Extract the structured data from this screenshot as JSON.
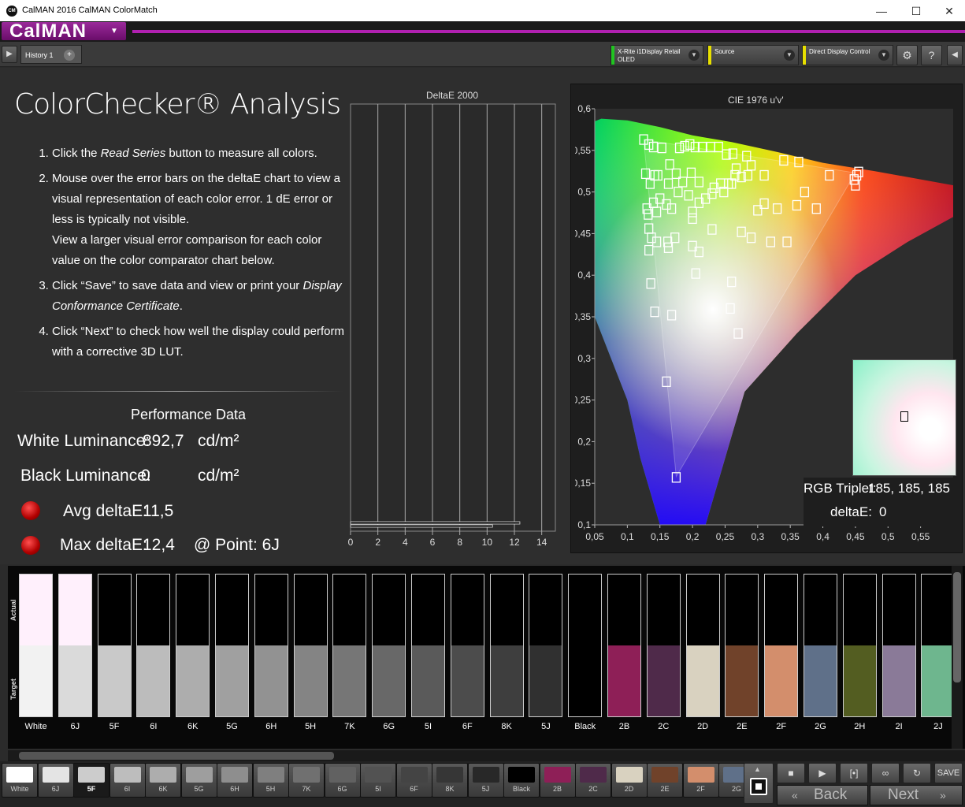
{
  "window": {
    "title": "CalMAN 2016 CalMAN ColorMatch",
    "app_badge": "CM"
  },
  "brand": {
    "name": "CalMAN"
  },
  "toolbar": {
    "history_tab": "History 1",
    "meter": {
      "line1": "X-Rite i1Display Retail",
      "line2": "OLED",
      "color": "#21c521"
    },
    "source": {
      "line1": "Source",
      "color": "#e8e000"
    },
    "display": {
      "line1": "Direct Display Control",
      "color": "#e8e000"
    }
  },
  "page": {
    "heading": "ColorChecker® Analysis",
    "steps": [
      [
        "Click the ",
        "Read Series",
        " button to measure all colors."
      ],
      [
        "Mouse over the error bars on the deltaE chart to view a visual representation of each color error. 1 dE error or less is typically not visible.",
        "View a larger visual error comparison for each color value on the color comparator chart below."
      ],
      [
        "Click “Save” to save data and view or print your ",
        "Display Conformance Certificate",
        "."
      ],
      [
        "Click “Next” to check how well the display could perform with a corrective 3D LUT."
      ]
    ]
  },
  "performance": {
    "title": "Performance Data",
    "white_label": "White Luminance:",
    "white_value": "892,7",
    "white_unit": "cd/m²",
    "black_label": "Black Luminance:",
    "black_value": "0",
    "black_unit": "cd/m²",
    "avg_label": "Avg deltaE:",
    "avg_value": "11,5",
    "max_label": "Max deltaE:",
    "max_value": "12,4",
    "point_label": "@ Point: 6J"
  },
  "chart_data": [
    {
      "type": "bar",
      "title": "DeltaE 2000",
      "orientation": "horizontal",
      "xlim": [
        0,
        15
      ],
      "xticks": [
        "0",
        "2",
        "4",
        "6",
        "8",
        "10",
        "12",
        "14"
      ],
      "values": [
        12.4,
        10.4
      ]
    },
    {
      "type": "scatter",
      "title": "CIE 1976 u'v'",
      "xlim": [
        0.05,
        0.6
      ],
      "ylim": [
        0.1,
        0.6
      ],
      "xticks": [
        "0,05",
        "0,1",
        "0,15",
        "0,2",
        "0,25",
        "0,3",
        "0,35",
        "0,4",
        "0,45",
        "0,5",
        "0,55"
      ],
      "yticks": [
        "0,1",
        "0,15",
        "0,2",
        "0,25",
        "0,3",
        "0,35",
        "0,4",
        "0,45",
        "0,5",
        "0,55",
        "0,6"
      ],
      "points": [
        [
          0.125,
          0.563
        ],
        [
          0.133,
          0.557
        ],
        [
          0.14,
          0.554
        ],
        [
          0.153,
          0.553
        ],
        [
          0.128,
          0.522
        ],
        [
          0.142,
          0.52
        ],
        [
          0.135,
          0.51
        ],
        [
          0.147,
          0.52
        ],
        [
          0.165,
          0.533
        ],
        [
          0.18,
          0.553
        ],
        [
          0.188,
          0.555
        ],
        [
          0.196,
          0.557
        ],
        [
          0.204,
          0.554
        ],
        [
          0.215,
          0.554
        ],
        [
          0.228,
          0.554
        ],
        [
          0.24,
          0.554
        ],
        [
          0.252,
          0.545
        ],
        [
          0.262,
          0.546
        ],
        [
          0.283,
          0.543
        ],
        [
          0.29,
          0.532
        ],
        [
          0.267,
          0.528
        ],
        [
          0.265,
          0.52
        ],
        [
          0.255,
          0.51
        ],
        [
          0.243,
          0.51
        ],
        [
          0.233,
          0.505
        ],
        [
          0.21,
          0.512
        ],
        [
          0.198,
          0.523
        ],
        [
          0.185,
          0.512
        ],
        [
          0.175,
          0.522
        ],
        [
          0.163,
          0.51
        ],
        [
          0.15,
          0.492
        ],
        [
          0.13,
          0.48
        ],
        [
          0.132,
          0.473
        ],
        [
          0.14,
          0.487
        ],
        [
          0.145,
          0.476
        ],
        [
          0.16,
          0.485
        ],
        [
          0.168,
          0.48
        ],
        [
          0.178,
          0.5
        ],
        [
          0.194,
          0.496
        ],
        [
          0.2,
          0.476
        ],
        [
          0.2,
          0.468
        ],
        [
          0.21,
          0.487
        ],
        [
          0.22,
          0.492
        ],
        [
          0.23,
          0.498
        ],
        [
          0.248,
          0.5
        ],
        [
          0.26,
          0.51
        ],
        [
          0.275,
          0.518
        ],
        [
          0.285,
          0.52
        ],
        [
          0.31,
          0.52
        ],
        [
          0.34,
          0.538
        ],
        [
          0.363,
          0.536
        ],
        [
          0.41,
          0.52
        ],
        [
          0.448,
          0.515
        ],
        [
          0.452,
          0.52
        ],
        [
          0.455,
          0.524
        ],
        [
          0.45,
          0.508
        ],
        [
          0.372,
          0.5
        ],
        [
          0.36,
          0.484
        ],
        [
          0.39,
          0.48
        ],
        [
          0.31,
          0.486
        ],
        [
          0.3,
          0.478
        ],
        [
          0.33,
          0.48
        ],
        [
          0.133,
          0.456
        ],
        [
          0.137,
          0.445
        ],
        [
          0.145,
          0.44
        ],
        [
          0.162,
          0.44
        ],
        [
          0.173,
          0.445
        ],
        [
          0.163,
          0.433
        ],
        [
          0.2,
          0.435
        ],
        [
          0.21,
          0.428
        ],
        [
          0.23,
          0.455
        ],
        [
          0.275,
          0.452
        ],
        [
          0.29,
          0.445
        ],
        [
          0.32,
          0.44
        ],
        [
          0.345,
          0.44
        ],
        [
          0.133,
          0.43
        ],
        [
          0.205,
          0.402
        ],
        [
          0.26,
          0.392
        ],
        [
          0.136,
          0.39
        ],
        [
          0.142,
          0.356
        ],
        [
          0.168,
          0.352
        ],
        [
          0.258,
          0.36
        ],
        [
          0.27,
          0.33
        ],
        [
          0.16,
          0.272
        ],
        [
          0.175,
          0.157
        ]
      ]
    }
  ],
  "selection": {
    "rgb_label": "RGB Triplet:",
    "rgb_value": "185, 185, 185",
    "de_label": "deltaE:",
    "de_value": "0"
  },
  "patches": {
    "actual_label": "Actual",
    "target_label": "Target",
    "items": [
      {
        "name": "White",
        "actual": "#fff0fc",
        "target": "#f2f2f2"
      },
      {
        "name": "6J",
        "actual": "#fff0fc",
        "target": "#dadada"
      },
      {
        "name": "5F",
        "actual": "#000000",
        "target": "#c9c9c9"
      },
      {
        "name": "6I",
        "actual": "#000000",
        "target": "#bcbcbc"
      },
      {
        "name": "6K",
        "actual": "#000000",
        "target": "#adadad"
      },
      {
        "name": "5G",
        "actual": "#000000",
        "target": "#a0a0a0"
      },
      {
        "name": "6H",
        "actual": "#000000",
        "target": "#929292"
      },
      {
        "name": "5H",
        "actual": "#000000",
        "target": "#848484"
      },
      {
        "name": "7K",
        "actual": "#000000",
        "target": "#767676"
      },
      {
        "name": "6G",
        "actual": "#000000",
        "target": "#686868"
      },
      {
        "name": "5I",
        "actual": "#000000",
        "target": "#5a5a5a"
      },
      {
        "name": "6F",
        "actual": "#000000",
        "target": "#4c4c4c"
      },
      {
        "name": "8K",
        "actual": "#000000",
        "target": "#3e3e3e"
      },
      {
        "name": "5J",
        "actual": "#000000",
        "target": "#303030"
      },
      {
        "name": "Black",
        "actual": "#000000",
        "target": "#000000"
      },
      {
        "name": "2B",
        "actual": "#000000",
        "target": "#8e1f57"
      },
      {
        "name": "2C",
        "actual": "#000000",
        "target": "#4f2a4a"
      },
      {
        "name": "2D",
        "actual": "#000000",
        "target": "#d9d2c0"
      },
      {
        "name": "2E",
        "actual": "#000000",
        "target": "#70422a"
      },
      {
        "name": "2F",
        "actual": "#000000",
        "target": "#d38e6c"
      },
      {
        "name": "2G",
        "actual": "#000000",
        "target": "#5f7089"
      },
      {
        "name": "2H",
        "actual": "#000000",
        "target": "#535d21"
      },
      {
        "name": "2I",
        "actual": "#000000",
        "target": "#8a7a98"
      },
      {
        "name": "2J",
        "actual": "#000000",
        "target": "#6eb68e"
      }
    ]
  },
  "thumbs": [
    {
      "name": "White",
      "color": "#ffffff"
    },
    {
      "name": "6J",
      "color": "#e4e4e4"
    },
    {
      "name": "5F",
      "color": "#cccccc"
    },
    {
      "name": "6I",
      "color": "#bdbdbd"
    },
    {
      "name": "6K",
      "color": "#adadad"
    },
    {
      "name": "5G",
      "color": "#9e9e9e"
    },
    {
      "name": "6H",
      "color": "#8e8e8e"
    },
    {
      "name": "5H",
      "color": "#7f7f7f"
    },
    {
      "name": "7K",
      "color": "#707070"
    },
    {
      "name": "6G",
      "color": "#616161"
    },
    {
      "name": "5I",
      "color": "#525252"
    },
    {
      "name": "6F",
      "color": "#444444"
    },
    {
      "name": "8K",
      "color": "#363636"
    },
    {
      "name": "5J",
      "color": "#282828"
    },
    {
      "name": "Black",
      "color": "#000000"
    },
    {
      "name": "2B",
      "color": "#8e1f57"
    },
    {
      "name": "2C",
      "color": "#4f2a4a"
    },
    {
      "name": "2D",
      "color": "#d9d2c0"
    },
    {
      "name": "2E",
      "color": "#70422a"
    },
    {
      "name": "2F",
      "color": "#d38e6c"
    },
    {
      "name": "2G",
      "color": "#5f7089"
    }
  ],
  "controls": {
    "save": "SAVE",
    "back": "Back",
    "next": "Next"
  }
}
